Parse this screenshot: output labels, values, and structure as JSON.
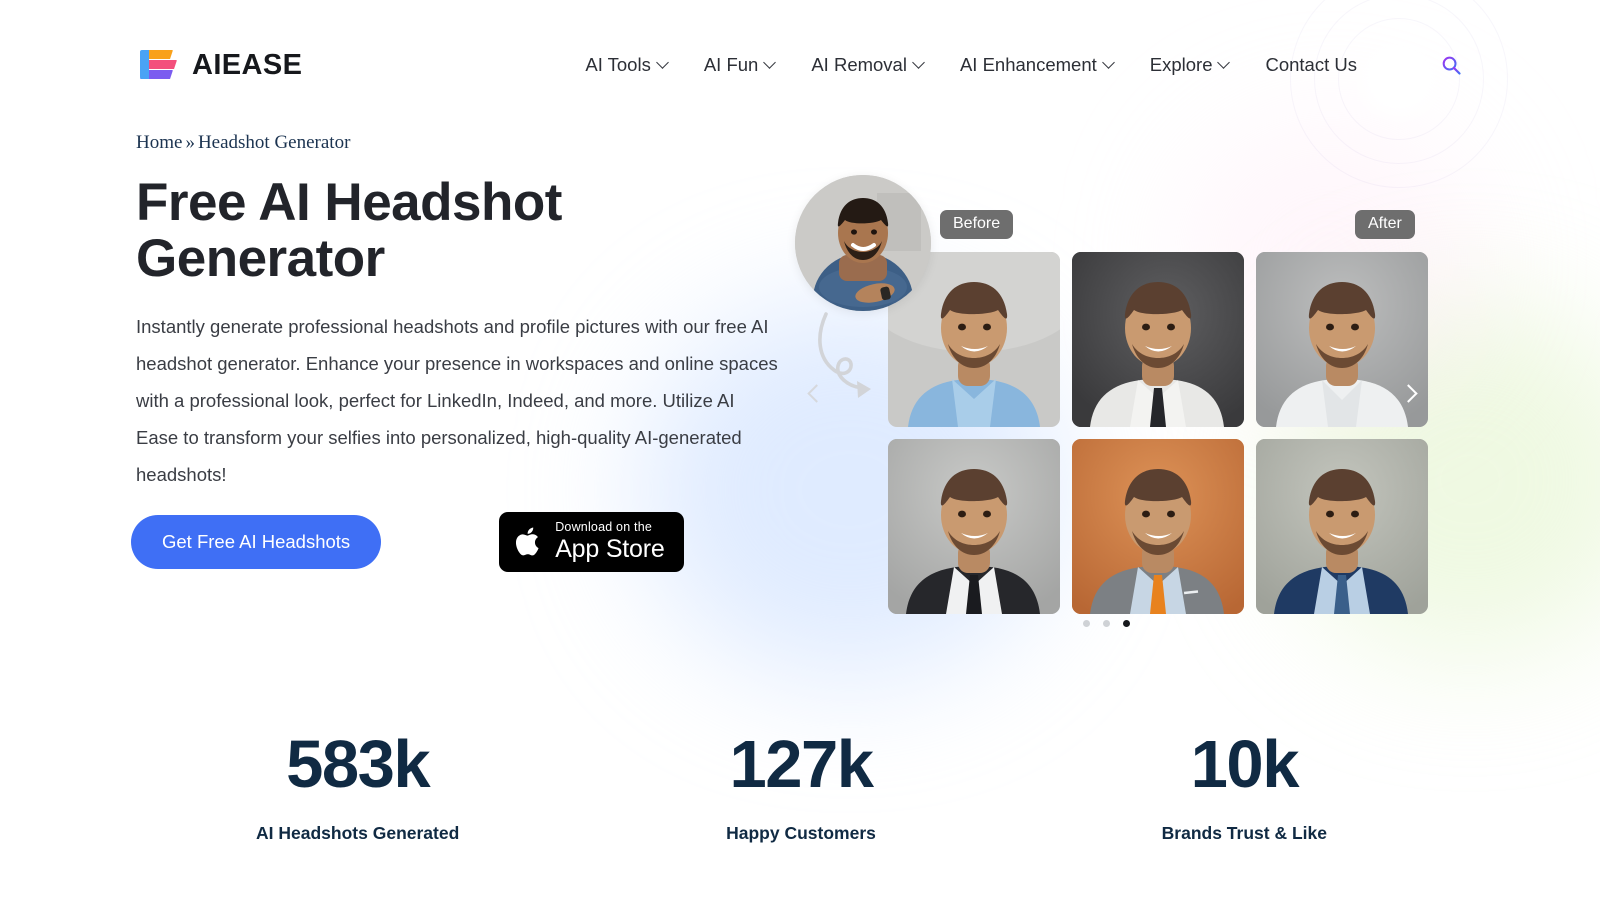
{
  "header": {
    "brand": {
      "name": "AIEASE",
      "logo_icon": "aiease-logo-icon"
    },
    "nav": [
      {
        "label": "AI Tools",
        "has_dropdown": true
      },
      {
        "label": "AI Fun",
        "has_dropdown": true
      },
      {
        "label": "AI Removal",
        "has_dropdown": true
      },
      {
        "label": "AI Enhancement",
        "has_dropdown": true
      },
      {
        "label": "Explore",
        "has_dropdown": true
      },
      {
        "label": "Contact Us",
        "has_dropdown": false
      }
    ],
    "search": {
      "icon": "search-icon",
      "color": "#8b3df0"
    }
  },
  "breadcrumb": {
    "home": "Home",
    "separator": "»",
    "current": "Headshot Generator"
  },
  "hero": {
    "title": "Free AI Headshot Generator",
    "description": "Instantly generate professional headshots and profile pictures with our free AI headshot generator. Enhance your presence in workspaces and online spaces with a professional look, perfect for LinkedIn, Indeed, and more. Utilize AI Ease to transform your selfies into personalized, high-quality AI-generated headshots!",
    "cta_label": "Get Free AI Headshots",
    "cta_color": "#3f6ff5",
    "appstore": {
      "small_text": "Download on the",
      "big_text": "App Store",
      "icon": "apple-icon",
      "background": "#000000"
    }
  },
  "carousel": {
    "before_badge": "Before",
    "after_badge": "After",
    "badge_color": "#6e6e6e",
    "prev_label": "Previous slide",
    "next_label": "Next slide",
    "avatar_alt": "Before photo - man in blue t-shirt with arms crossed",
    "dots": [
      {
        "active": false
      },
      {
        "active": false
      },
      {
        "active": true
      }
    ],
    "photos": [
      {
        "alt": "Headshot on light gray background, blue dress shirt",
        "bg": "#c9c9c7",
        "suit": "#6d9bc9",
        "shirt": "#89b6dd",
        "tie": "none"
      },
      {
        "alt": "Headshot on dark gray background, white suit with black tie",
        "bg": "#4a4a4c",
        "suit": "#e8e8e6",
        "shirt": "#f2f2f0",
        "tie": "#25262a"
      },
      {
        "alt": "Headshot on gray background, white dress shirt",
        "bg": "#a9aaab",
        "suit": "#e4e6e7",
        "shirt": "#eef0f1",
        "tie": "none"
      },
      {
        "alt": "Headshot on gray background, black suit with black tie",
        "bg": "#b6b7b6",
        "suit": "#26272b",
        "shirt": "#f0f1f2",
        "tie": "#1a1b1f"
      },
      {
        "alt": "Headshot on orange background, gray suit with orange tie",
        "bg": "#c9783f",
        "suit": "#7c8084",
        "shirt": "#c7d6e4",
        "tie": "#e8821e"
      },
      {
        "alt": "Headshot on gray-green background, navy blue suit with blue tie",
        "bg": "#b0b2ab",
        "suit": "#1f3a63",
        "shirt": "#b9cfe4",
        "tie": "#3a5f8a"
      }
    ]
  },
  "stats": [
    {
      "value": "583k",
      "label": "AI Headshots Generated"
    },
    {
      "value": "127k",
      "label": "Happy Customers"
    },
    {
      "value": "10k",
      "label": "Brands Trust & Like"
    }
  ]
}
